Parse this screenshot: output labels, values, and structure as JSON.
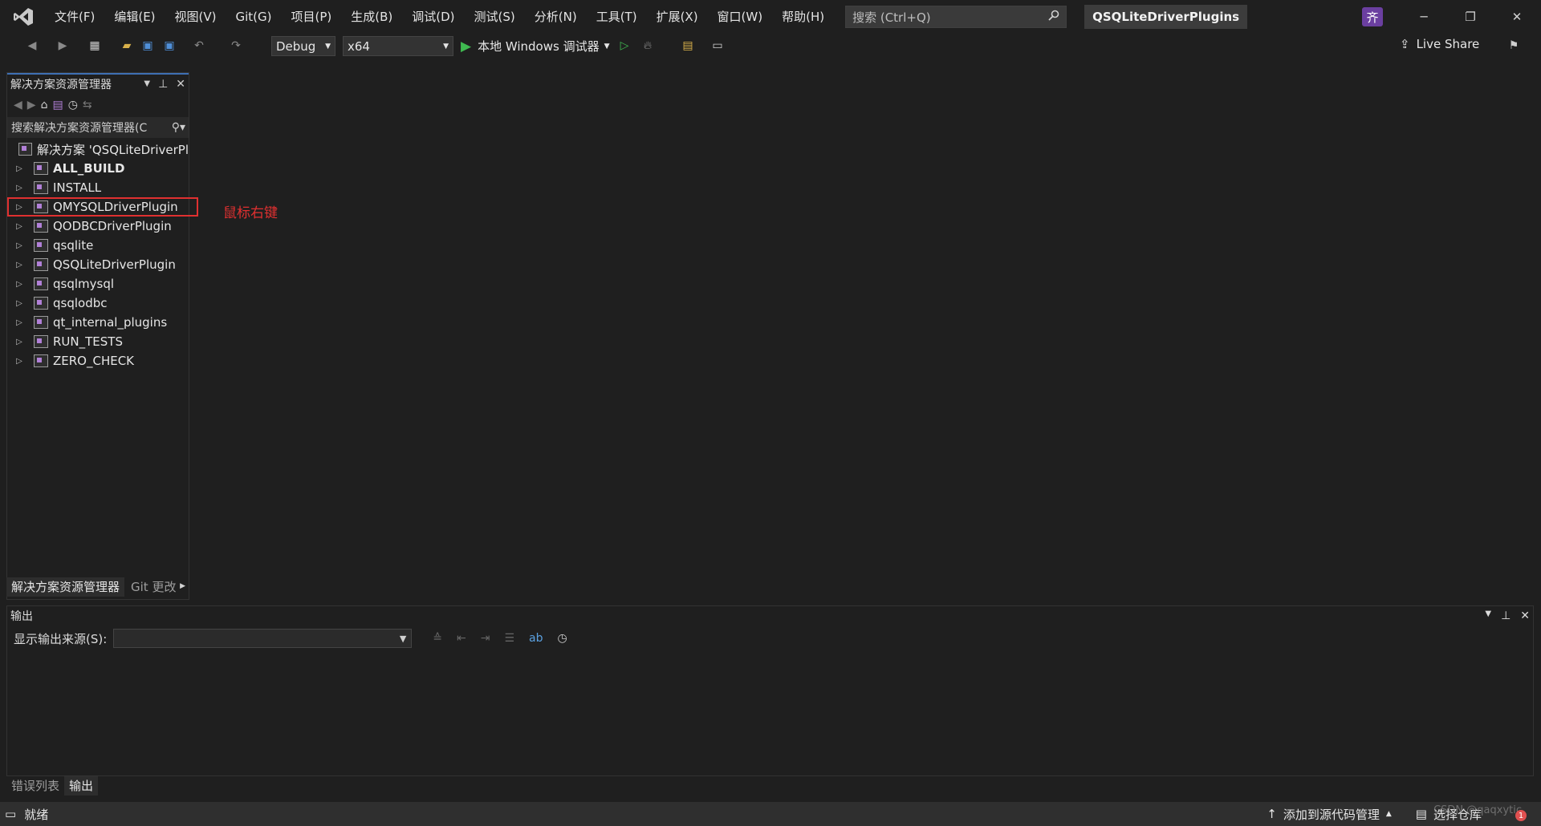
{
  "menu": {
    "items": [
      "文件(F)",
      "编辑(E)",
      "视图(V)",
      "Git(G)",
      "项目(P)",
      "生成(B)",
      "调试(D)",
      "测试(S)",
      "分析(N)",
      "工具(T)",
      "扩展(X)",
      "窗口(W)",
      "帮助(H)"
    ]
  },
  "search": {
    "placeholder": "搜索 (Ctrl+Q)"
  },
  "solution_title": "QSQLiteDriverPlugins",
  "avatar_initial": "齐",
  "toolbar": {
    "config": "Debug",
    "platform": "x64",
    "run_label": "本地 Windows 调试器",
    "live_share": "Live Share"
  },
  "solution_explorer": {
    "title": "解决方案资源管理器",
    "search_placeholder": "搜索解决方案资源管理器(C",
    "solution_label": "解决方案 'QSQLiteDriverPl",
    "projects": [
      {
        "name": "ALL_BUILD",
        "bold": true
      },
      {
        "name": "INSTALL"
      },
      {
        "name": "QMYSQLDriverPlugin",
        "highlighted": true
      },
      {
        "name": "QODBCDriverPlugin"
      },
      {
        "name": "qsqlite"
      },
      {
        "name": "QSQLiteDriverPlugin"
      },
      {
        "name": "qsqlmysql"
      },
      {
        "name": "qsqlodbc"
      },
      {
        "name": "qt_internal_plugins"
      },
      {
        "name": "RUN_TESTS"
      },
      {
        "name": "ZERO_CHECK"
      }
    ],
    "tabs": [
      "解决方案资源管理器",
      "Git 更改"
    ]
  },
  "annotation": "鼠标右键",
  "output": {
    "title": "输出",
    "source_label": "显示输出来源(S):",
    "source_value": ""
  },
  "bottom_tabs": [
    "错误列表",
    "输出"
  ],
  "statusbar": {
    "ready": "就绪",
    "add_to_source": "添加到源代码管理",
    "select_repo": "选择仓库"
  },
  "watermark": "CSDN @qaqxytic",
  "notification_count": "1",
  "colors": {
    "accent": "#3e6fb3",
    "highlight": "#e03030",
    "avatar": "#6b3fa0"
  }
}
